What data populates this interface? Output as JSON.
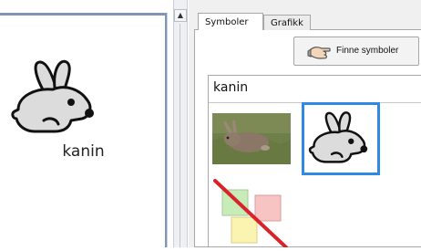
{
  "card": {
    "label": "kanin"
  },
  "scrollbar": {
    "up_arrow": "▲"
  },
  "tabs": [
    {
      "label": "Symboler",
      "active": true
    },
    {
      "label": "Grafikk",
      "active": false
    }
  ],
  "toolbar": {
    "find_symbols_label": "Finne symboler",
    "icon": "hand-pointing-icon"
  },
  "results": {
    "search_word": "kanin",
    "items": [
      {
        "kind": "photo",
        "icon": "rabbit-photo"
      },
      {
        "kind": "symbol",
        "icon": "rabbit-symbol",
        "selected": true
      },
      {
        "kind": "no-symbol",
        "icon": "no-symbol-icon"
      }
    ]
  },
  "colors": {
    "selection": "#2f8ae6",
    "panel_bg": "#f0f0f0",
    "card_border": "#7e95b8",
    "no_symbol_line": "#d8232a"
  }
}
